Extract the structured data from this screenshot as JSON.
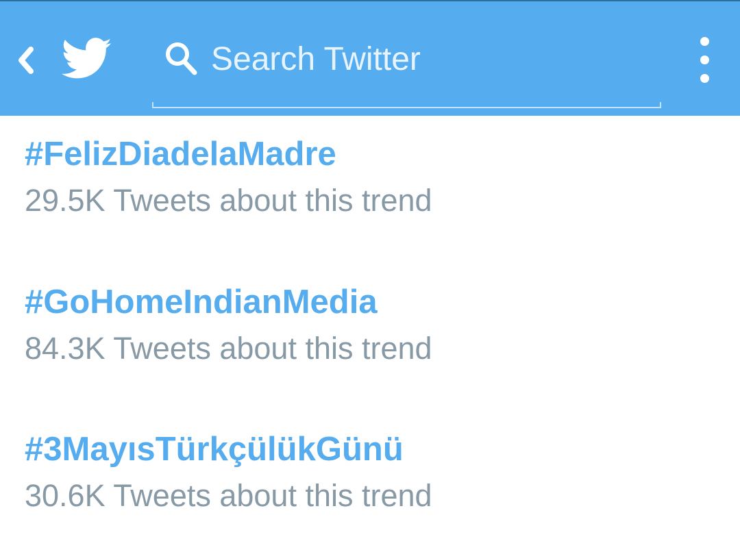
{
  "app": {
    "name": "Twitter"
  },
  "header": {
    "back_icon": "chevron-left-icon",
    "logo_icon": "twitter-bird-icon",
    "search": {
      "placeholder": "Search Twitter",
      "value": "",
      "icon": "search-icon"
    },
    "menu_icon": "kebab-menu-icon",
    "colors": {
      "bar": "#55acee",
      "text": "#ffffff"
    }
  },
  "trends": [
    {
      "name": "#FelizDiadelaMadre",
      "count": "29.5K Tweets about this trend"
    },
    {
      "name": "#GoHomeIndianMedia",
      "count": "84.3K Tweets about this trend"
    },
    {
      "name": "#3MayısTürkçülükGünü",
      "count": "30.6K Tweets about this trend"
    }
  ],
  "colors": {
    "trend_name": "#55acee",
    "trend_count": "#8899a6",
    "background": "#ffffff"
  }
}
